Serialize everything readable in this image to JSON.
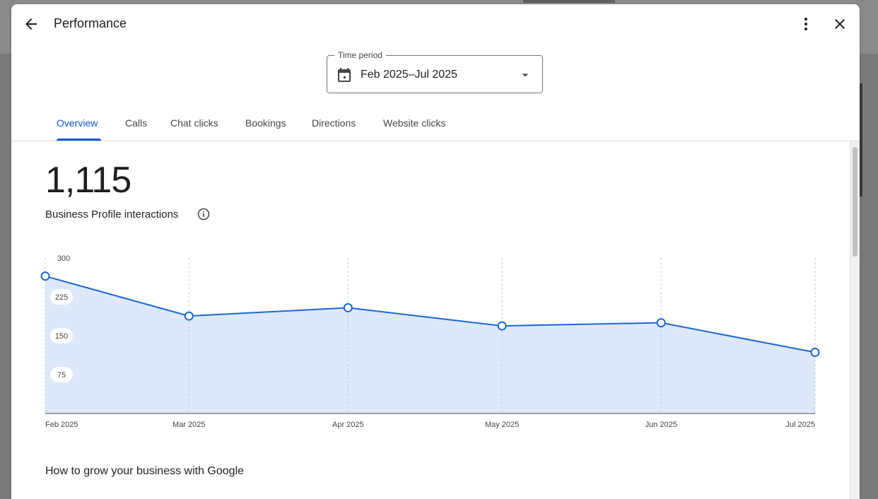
{
  "header": {
    "title": "Performance"
  },
  "time_period": {
    "label": "Time period",
    "value": "Feb 2025–Jul 2025"
  },
  "tabs": [
    {
      "label": "Overview",
      "active": true
    },
    {
      "label": "Calls"
    },
    {
      "label": "Chat clicks"
    },
    {
      "label": "Bookings"
    },
    {
      "label": "Directions"
    },
    {
      "label": "Website clicks"
    }
  ],
  "summary": {
    "total": "1,115",
    "label": "Business Profile interactions"
  },
  "section": {
    "grow_title": "How to grow your business with Google"
  },
  "colors": {
    "accent": "#0b57d0",
    "line": "#1a66d6",
    "area": "#dde8fa"
  },
  "chart_data": {
    "type": "area",
    "categories": [
      "Feb 2025",
      "Mar 2025",
      "Apr 2025",
      "May 2025",
      "Jun 2025",
      "Jul 2025"
    ],
    "x_positions": [
      0,
      28,
      59,
      89,
      120,
      150
    ],
    "values": [
      265,
      188,
      204,
      169,
      175,
      118
    ],
    "yticks": [
      75,
      150,
      225,
      300
    ],
    "ylim": [
      0,
      300
    ],
    "grid": true
  }
}
